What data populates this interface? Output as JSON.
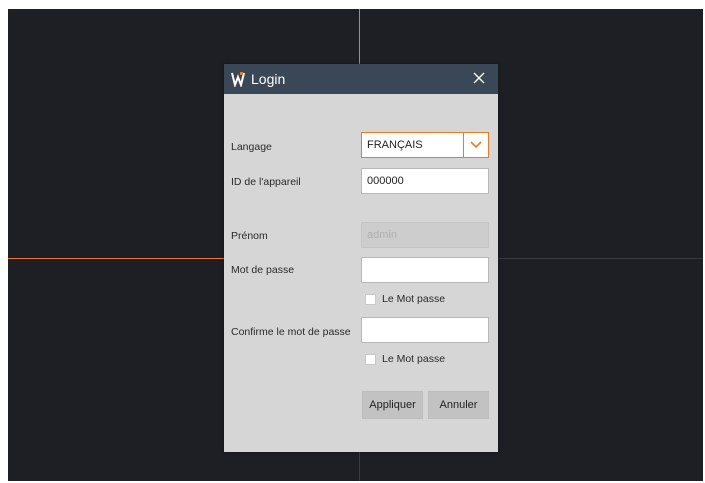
{
  "dialog": {
    "title": "Login",
    "logo_icon": "W-logo",
    "close_icon": "close-icon"
  },
  "form": {
    "language_label": "Langage",
    "language_value": "FRANÇAIS",
    "device_id_label": "ID de l'appareil",
    "device_id_value": "000000",
    "username_label": "Prénom",
    "username_value": "admin",
    "password_label": "Mot de passe",
    "password_value": "",
    "show_password_label": "Le Mot passe",
    "confirm_label": "Confirme le mot de passe",
    "confirm_value": "",
    "show_confirm_label": "Le Mot passe",
    "apply_label": "Appliquer",
    "cancel_label": "Annuler"
  },
  "colors": {
    "accent": "#f07820",
    "titlebar": "#3a4756",
    "dialog_bg": "#d6d6d6",
    "screen_bg": "#1e1f24"
  }
}
